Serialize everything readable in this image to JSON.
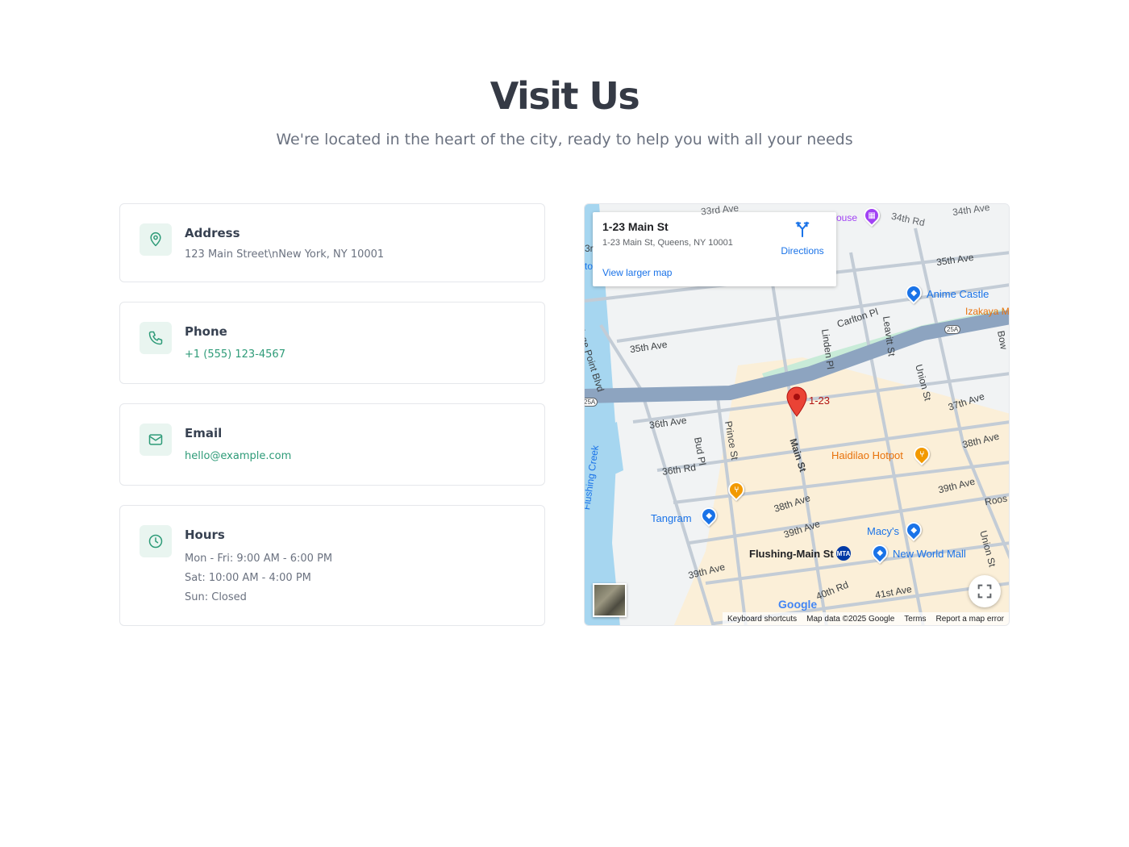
{
  "hero": {
    "title": "Visit Us",
    "subtitle": "We're located in the heart of the city, ready to help you with all your needs"
  },
  "contact": {
    "address": {
      "title": "Address",
      "value": "123 Main Street\\nNew York, NY 10001",
      "icon": "map-pin-icon"
    },
    "phone": {
      "title": "Phone",
      "value": "+1 (555) 123-4567",
      "icon": "phone-icon"
    },
    "email": {
      "title": "Email",
      "value": "hello@example.com",
      "icon": "mail-icon"
    },
    "hours": {
      "title": "Hours",
      "icon": "clock-icon",
      "lines": [
        "Mon - Fri: 9:00 AM - 6:00 PM",
        "Sat: 10:00 AM - 4:00 PM",
        "Sun: Closed"
      ]
    }
  },
  "map": {
    "info": {
      "name": "1-23 Main St",
      "address": "1-23 Main St, Queens, NY 10001",
      "directions": "Directions",
      "larger": "View larger map"
    },
    "marker_label": "1-23",
    "labels": {
      "ave33": "33rd Ave",
      "rd34": "34th Rd",
      "ave34": "34th Ave",
      "ave35a": "35th Ave",
      "ave35b": "35th Ave",
      "ave36": "36th Ave",
      "rd36": "36th Rd",
      "ave37": "37th Ave",
      "ave38": "38th Ave",
      "ave38b": "38th Ave",
      "ave39a": "39th Ave",
      "ave39b": "39th Ave",
      "ave39c": "39th Ave",
      "rd40": "40th Rd",
      "ave41": "41st Ave",
      "college": "College Point Blvd",
      "linden": "Linden Pl",
      "carlton": "Carlton Pl",
      "leavitt": "Leavitt St",
      "union": "Union St",
      "union2": "Union St",
      "prince": "Prince St",
      "bud": "Bud Pl",
      "main": "Main St",
      "creek": "Flushing Creek",
      "roos": "Roos",
      "bow": "Bow",
      "house": "ouse",
      "to": "to",
      "r3": "3r",
      "anime": "Anime Castle",
      "izakaya": "Izakaya M",
      "haidilao": "Haidilao Hotpot",
      "tangram": "Tangram",
      "macys": "Macy's",
      "newworld": "New World Mall",
      "flushing": "Flushing-Main St",
      "shield25a": "25A",
      "shield25b": "25A"
    },
    "google": "Google",
    "attribution": {
      "keyboard": "Keyboard shortcuts",
      "data": "Map data ©2025 Google",
      "terms": "Terms",
      "report": "Report a map error"
    }
  }
}
